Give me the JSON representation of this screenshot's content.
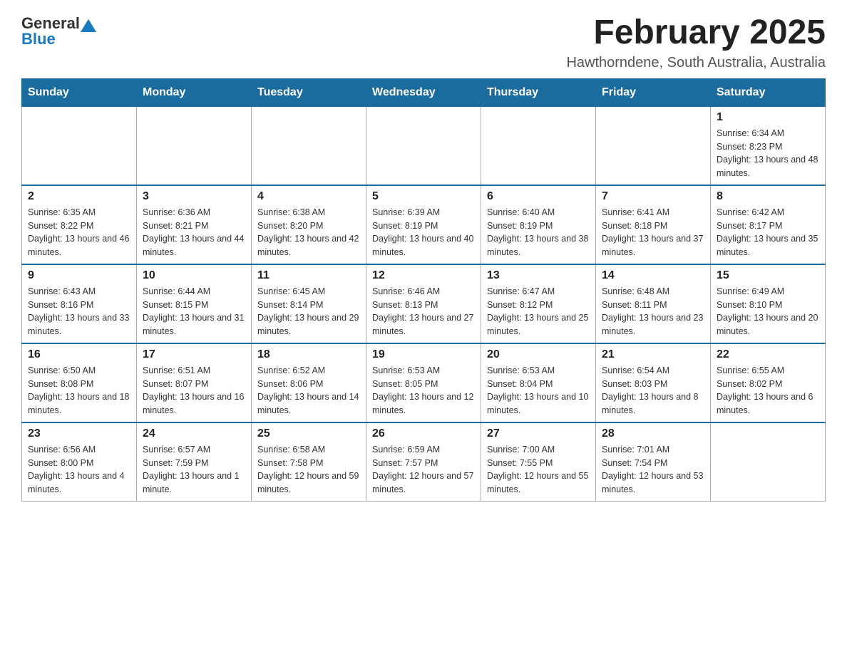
{
  "header": {
    "logo_general": "General",
    "logo_blue": "Blue",
    "title": "February 2025",
    "subtitle": "Hawthorndene, South Australia, Australia"
  },
  "weekdays": [
    "Sunday",
    "Monday",
    "Tuesday",
    "Wednesday",
    "Thursday",
    "Friday",
    "Saturday"
  ],
  "weeks": [
    [
      {
        "day": "",
        "info": ""
      },
      {
        "day": "",
        "info": ""
      },
      {
        "day": "",
        "info": ""
      },
      {
        "day": "",
        "info": ""
      },
      {
        "day": "",
        "info": ""
      },
      {
        "day": "",
        "info": ""
      },
      {
        "day": "1",
        "info": "Sunrise: 6:34 AM\nSunset: 8:23 PM\nDaylight: 13 hours and 48 minutes."
      }
    ],
    [
      {
        "day": "2",
        "info": "Sunrise: 6:35 AM\nSunset: 8:22 PM\nDaylight: 13 hours and 46 minutes."
      },
      {
        "day": "3",
        "info": "Sunrise: 6:36 AM\nSunset: 8:21 PM\nDaylight: 13 hours and 44 minutes."
      },
      {
        "day": "4",
        "info": "Sunrise: 6:38 AM\nSunset: 8:20 PM\nDaylight: 13 hours and 42 minutes."
      },
      {
        "day": "5",
        "info": "Sunrise: 6:39 AM\nSunset: 8:19 PM\nDaylight: 13 hours and 40 minutes."
      },
      {
        "day": "6",
        "info": "Sunrise: 6:40 AM\nSunset: 8:19 PM\nDaylight: 13 hours and 38 minutes."
      },
      {
        "day": "7",
        "info": "Sunrise: 6:41 AM\nSunset: 8:18 PM\nDaylight: 13 hours and 37 minutes."
      },
      {
        "day": "8",
        "info": "Sunrise: 6:42 AM\nSunset: 8:17 PM\nDaylight: 13 hours and 35 minutes."
      }
    ],
    [
      {
        "day": "9",
        "info": "Sunrise: 6:43 AM\nSunset: 8:16 PM\nDaylight: 13 hours and 33 minutes."
      },
      {
        "day": "10",
        "info": "Sunrise: 6:44 AM\nSunset: 8:15 PM\nDaylight: 13 hours and 31 minutes."
      },
      {
        "day": "11",
        "info": "Sunrise: 6:45 AM\nSunset: 8:14 PM\nDaylight: 13 hours and 29 minutes."
      },
      {
        "day": "12",
        "info": "Sunrise: 6:46 AM\nSunset: 8:13 PM\nDaylight: 13 hours and 27 minutes."
      },
      {
        "day": "13",
        "info": "Sunrise: 6:47 AM\nSunset: 8:12 PM\nDaylight: 13 hours and 25 minutes."
      },
      {
        "day": "14",
        "info": "Sunrise: 6:48 AM\nSunset: 8:11 PM\nDaylight: 13 hours and 23 minutes."
      },
      {
        "day": "15",
        "info": "Sunrise: 6:49 AM\nSunset: 8:10 PM\nDaylight: 13 hours and 20 minutes."
      }
    ],
    [
      {
        "day": "16",
        "info": "Sunrise: 6:50 AM\nSunset: 8:08 PM\nDaylight: 13 hours and 18 minutes."
      },
      {
        "day": "17",
        "info": "Sunrise: 6:51 AM\nSunset: 8:07 PM\nDaylight: 13 hours and 16 minutes."
      },
      {
        "day": "18",
        "info": "Sunrise: 6:52 AM\nSunset: 8:06 PM\nDaylight: 13 hours and 14 minutes."
      },
      {
        "day": "19",
        "info": "Sunrise: 6:53 AM\nSunset: 8:05 PM\nDaylight: 13 hours and 12 minutes."
      },
      {
        "day": "20",
        "info": "Sunrise: 6:53 AM\nSunset: 8:04 PM\nDaylight: 13 hours and 10 minutes."
      },
      {
        "day": "21",
        "info": "Sunrise: 6:54 AM\nSunset: 8:03 PM\nDaylight: 13 hours and 8 minutes."
      },
      {
        "day": "22",
        "info": "Sunrise: 6:55 AM\nSunset: 8:02 PM\nDaylight: 13 hours and 6 minutes."
      }
    ],
    [
      {
        "day": "23",
        "info": "Sunrise: 6:56 AM\nSunset: 8:00 PM\nDaylight: 13 hours and 4 minutes."
      },
      {
        "day": "24",
        "info": "Sunrise: 6:57 AM\nSunset: 7:59 PM\nDaylight: 13 hours and 1 minute."
      },
      {
        "day": "25",
        "info": "Sunrise: 6:58 AM\nSunset: 7:58 PM\nDaylight: 12 hours and 59 minutes."
      },
      {
        "day": "26",
        "info": "Sunrise: 6:59 AM\nSunset: 7:57 PM\nDaylight: 12 hours and 57 minutes."
      },
      {
        "day": "27",
        "info": "Sunrise: 7:00 AM\nSunset: 7:55 PM\nDaylight: 12 hours and 55 minutes."
      },
      {
        "day": "28",
        "info": "Sunrise: 7:01 AM\nSunset: 7:54 PM\nDaylight: 12 hours and 53 minutes."
      },
      {
        "day": "",
        "info": ""
      }
    ]
  ]
}
